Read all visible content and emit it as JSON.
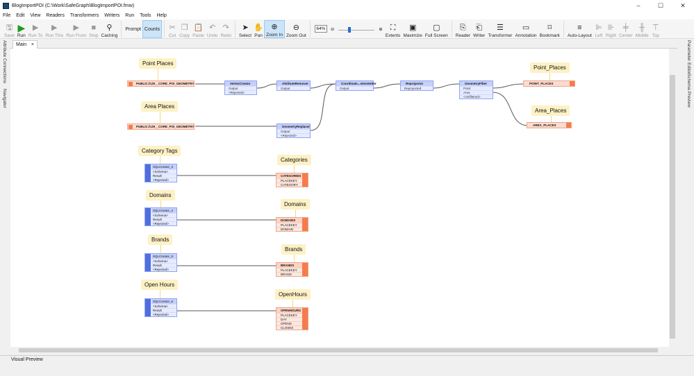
{
  "window": {
    "title": "BlogImportPOI (C:\\Work\\SafeGraph\\BlogImportPOI.fmw)"
  },
  "menu": [
    "File",
    "Edit",
    "View",
    "Readers",
    "Transformers",
    "Writers",
    "Run",
    "Tools",
    "Help"
  ],
  "toolbar": {
    "buttons": [
      {
        "label": "Save",
        "icon": "save-icon",
        "state": "disabled"
      },
      {
        "label": "Run",
        "icon": "play-icon",
        "state": "normal"
      },
      {
        "label": "Run To",
        "icon": "run-to-icon",
        "state": "disabled"
      },
      {
        "label": "Run This",
        "icon": "run-this-icon",
        "state": "disabled"
      },
      {
        "label": "Run From",
        "icon": "run-from-icon",
        "state": "disabled"
      },
      {
        "label": "Stop",
        "icon": "stop-icon",
        "state": "disabled"
      },
      {
        "label": "Caching",
        "icon": "caching-icon",
        "state": "normal"
      },
      {
        "label": "Prompt",
        "state": "normal"
      },
      {
        "label": "Counts",
        "state": "active"
      },
      {
        "label": "Cut",
        "icon": "cut-icon",
        "state": "disabled"
      },
      {
        "label": "Copy",
        "icon": "copy-icon",
        "state": "disabled"
      },
      {
        "label": "Paste",
        "icon": "paste-icon",
        "state": "disabled"
      },
      {
        "label": "Undo",
        "icon": "undo-icon",
        "state": "disabled"
      },
      {
        "label": "Redo",
        "icon": "redo-icon",
        "state": "disabled"
      },
      {
        "label": "Select",
        "icon": "cursor-icon",
        "state": "normal"
      },
      {
        "label": "Pan",
        "icon": "hand-icon",
        "state": "normal"
      },
      {
        "label": "Zoom In",
        "icon": "zoom-in-icon",
        "state": "active"
      },
      {
        "label": "Zoom Out",
        "icon": "zoom-out-icon",
        "state": "normal"
      }
    ],
    "zoom": "64%",
    "buttons2": [
      {
        "label": "Extents",
        "icon": "extents-icon",
        "state": "normal"
      },
      {
        "label": "Maximize",
        "icon": "maximize-icon",
        "state": "normal"
      },
      {
        "label": "Full Screen",
        "icon": "fullscreen-icon",
        "state": "normal"
      },
      {
        "label": "Reader",
        "icon": "reader-icon",
        "state": "normal"
      },
      {
        "label": "Writer",
        "icon": "writer-icon",
        "state": "normal"
      },
      {
        "label": "Transformer",
        "icon": "transformer-icon",
        "state": "normal"
      },
      {
        "label": "Annotation",
        "icon": "annotation-icon",
        "state": "normal"
      },
      {
        "label": "Bookmark",
        "icon": "bookmark-icon",
        "state": "normal"
      },
      {
        "label": "Auto-Layout",
        "icon": "auto-layout-icon",
        "state": "normal"
      },
      {
        "label": "Left",
        "icon": "align-left-icon",
        "state": "disabled"
      },
      {
        "label": "Right",
        "icon": "align-right-icon",
        "state": "disabled"
      },
      {
        "label": "Center",
        "icon": "align-center-icon",
        "state": "disabled"
      },
      {
        "label": "Middle",
        "icon": "align-middle-icon",
        "state": "disabled"
      },
      {
        "label": "Top",
        "icon": "align-top-icon",
        "state": "disabled"
      }
    ]
  },
  "left_panels": [
    "Attribute Connections",
    "Navigator"
  ],
  "right_panels": [
    "Parameter Editor",
    "Schema Preview"
  ],
  "tabs": [
    {
      "label": "Main",
      "close": "×"
    }
  ],
  "bottom_panel": "Visual Preview",
  "canvas": {
    "annotations": [
      "Point Places",
      "Area Places",
      "Point_Places",
      "Area_Places",
      "Category Tags",
      "Categories",
      "Domains",
      "Domains",
      "Brands",
      "Brands",
      "Open Hours",
      "OpenHours"
    ],
    "readers": [
      "PUBLIC.fc29__CORE_POI_GEOMETRY",
      "PUBLIC.fc29__CORE_POI_GEOMETRY"
    ],
    "transformers": [
      {
        "name": "VertexCreator",
        "ports": [
          "Output",
          "<Rejected>"
        ]
      },
      {
        "name": "AttributeRemover",
        "ports": [
          "Output"
        ]
      },
      {
        "name": "GeometryReplacer",
        "ports": [
          "Output",
          "<Rejected>"
        ]
      },
      {
        "name": "Coordinate...stemSetter",
        "ports": [
          "Output"
        ]
      },
      {
        "name": "Reprojector",
        "ports": [
          "Reprojected"
        ]
      },
      {
        "name": "GeometryFilter",
        "ports": [
          "Point",
          "Area",
          "<Unfiltered>"
        ]
      }
    ],
    "feature_writers": [
      "POINT_PLACES",
      "AREA_PLACES"
    ],
    "sql_creators": [
      {
        "name": "SQLCreator_3",
        "ports": [
          "<Schema>",
          "Result",
          "<Rejected>"
        ]
      },
      {
        "name": "SQLCreator_4",
        "ports": [
          "<Schema>",
          "Result",
          "<Rejected>"
        ]
      },
      {
        "name": "SQLCreator_5",
        "ports": [
          "<Schema>",
          "Result",
          "<Rejected>"
        ]
      },
      {
        "name": "SQLCreator_6",
        "ports": [
          "<Schema>",
          "Result",
          "<Rejected>"
        ]
      }
    ],
    "table_writers": [
      {
        "name": "CATEGORIES",
        "attrs": [
          "PLACEKEY",
          "CATEGORY"
        ]
      },
      {
        "name": "DOMAINS",
        "attrs": [
          "PLACEKEY",
          "DOMAIN"
        ]
      },
      {
        "name": "BRANDS",
        "attrs": [
          "PLACEKEY",
          "BRAND"
        ]
      },
      {
        "name": "OPENHOURS",
        "attrs": [
          "PLACEKEY",
          "DAY",
          "OPENS",
          "CLOSES"
        ]
      }
    ]
  },
  "colors": {
    "reader_writer": "#f47c4c",
    "transformer": "#8fa4f0",
    "annotation": "#fdf1c5",
    "run": "#1a9c1a"
  }
}
